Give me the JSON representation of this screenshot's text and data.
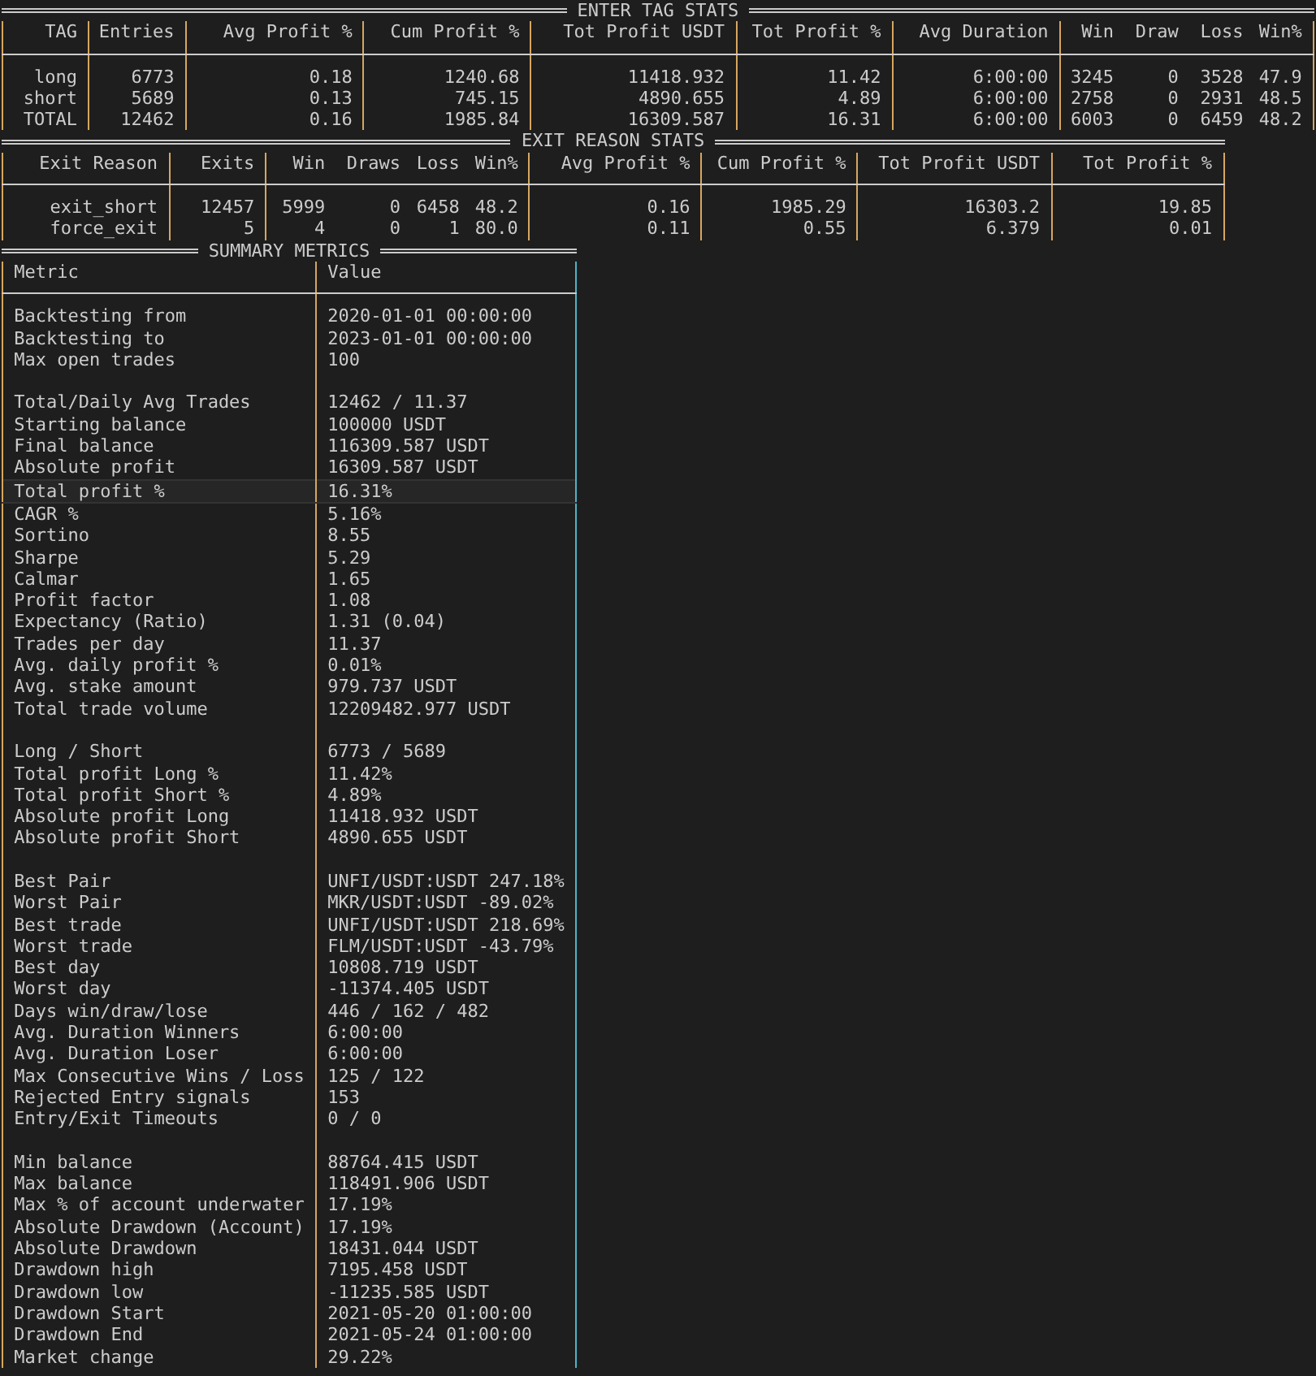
{
  "enter_tag_stats": {
    "title": "ENTER TAG STATS",
    "column_groups": [
      [
        "TAG"
      ],
      [
        "Entries"
      ],
      [
        "Avg Profit %"
      ],
      [
        "Cum Profit %"
      ],
      [
        "Tot Profit USDT"
      ],
      [
        "Tot Profit %"
      ],
      [
        "Avg Duration"
      ],
      [
        "Win",
        "Draw",
        "Loss",
        "Win%"
      ]
    ],
    "rows": [
      [
        "long",
        "6773",
        "0.18",
        "1240.68",
        "11418.932",
        "11.42",
        "6:00:00",
        "3245",
        "0",
        "3528",
        "47.9"
      ],
      [
        "short",
        "5689",
        "0.13",
        "745.15",
        "4890.655",
        "4.89",
        "6:00:00",
        "2758",
        "0",
        "2931",
        "48.5"
      ],
      [
        "TOTAL",
        "12462",
        "0.16",
        "1985.84",
        "16309.587",
        "16.31",
        "6:00:00",
        "6003",
        "0",
        "6459",
        "48.2"
      ]
    ]
  },
  "exit_reason_stats": {
    "title": "EXIT REASON STATS",
    "column_groups": [
      [
        "Exit Reason"
      ],
      [
        "Exits"
      ],
      [
        "Win",
        "Draws",
        "Loss",
        "Win%"
      ],
      [
        "Avg Profit %"
      ],
      [
        "Cum Profit %"
      ],
      [
        "Tot Profit USDT"
      ],
      [
        "Tot Profit %"
      ]
    ],
    "rows": [
      [
        "exit_short",
        "12457",
        "5999",
        "0",
        "6458",
        "48.2",
        "0.16",
        "1985.29",
        "16303.2",
        "19.85"
      ],
      [
        "force_exit",
        "5",
        "4",
        "0",
        "1",
        "80.0",
        "0.11",
        "0.55",
        "6.379",
        "0.01"
      ]
    ]
  },
  "summary_metrics": {
    "title": "SUMMARY METRICS",
    "columns": [
      "Metric",
      "Value"
    ],
    "groups": [
      [
        {
          "metric": "Backtesting from",
          "value": "2020-01-01 00:00:00",
          "selected": false
        },
        {
          "metric": "Backtesting to",
          "value": "2023-01-01 00:00:00",
          "selected": false
        },
        {
          "metric": "Max open trades",
          "value": "100",
          "selected": false
        }
      ],
      [
        {
          "metric": "Total/Daily Avg Trades",
          "value": "12462 / 11.37",
          "selected": false
        },
        {
          "metric": "Starting balance",
          "value": "100000 USDT",
          "selected": false
        },
        {
          "metric": "Final balance",
          "value": "116309.587 USDT",
          "selected": false
        },
        {
          "metric": "Absolute profit",
          "value": "16309.587 USDT",
          "selected": false
        },
        {
          "metric": "Total profit %",
          "value": "16.31%",
          "selected": true
        },
        {
          "metric": "CAGR %",
          "value": "5.16%",
          "selected": false
        },
        {
          "metric": "Sortino",
          "value": "8.55",
          "selected": false
        },
        {
          "metric": "Sharpe",
          "value": "5.29",
          "selected": false
        },
        {
          "metric": "Calmar",
          "value": "1.65",
          "selected": false
        },
        {
          "metric": "Profit factor",
          "value": "1.08",
          "selected": false
        },
        {
          "metric": "Expectancy (Ratio)",
          "value": "1.31 (0.04)",
          "selected": false
        },
        {
          "metric": "Trades per day",
          "value": "11.37",
          "selected": false
        },
        {
          "metric": "Avg. daily profit %",
          "value": "0.01%",
          "selected": false
        },
        {
          "metric": "Avg. stake amount",
          "value": "979.737 USDT",
          "selected": false
        },
        {
          "metric": "Total trade volume",
          "value": "12209482.977 USDT",
          "selected": false
        }
      ],
      [
        {
          "metric": "Long / Short",
          "value": "6773 / 5689",
          "selected": false
        },
        {
          "metric": "Total profit Long %",
          "value": "11.42%",
          "selected": false
        },
        {
          "metric": "Total profit Short %",
          "value": "4.89%",
          "selected": false
        },
        {
          "metric": "Absolute profit Long",
          "value": "11418.932 USDT",
          "selected": false
        },
        {
          "metric": "Absolute profit Short",
          "value": "4890.655 USDT",
          "selected": false
        }
      ],
      [
        {
          "metric": "Best Pair",
          "value": "UNFI/USDT:USDT 247.18%",
          "selected": false
        },
        {
          "metric": "Worst Pair",
          "value": "MKR/USDT:USDT -89.02%",
          "selected": false
        },
        {
          "metric": "Best trade",
          "value": "UNFI/USDT:USDT 218.69%",
          "selected": false
        },
        {
          "metric": "Worst trade",
          "value": "FLM/USDT:USDT -43.79%",
          "selected": false
        },
        {
          "metric": "Best day",
          "value": "10808.719 USDT",
          "selected": false
        },
        {
          "metric": "Worst day",
          "value": "-11374.405 USDT",
          "selected": false
        },
        {
          "metric": "Days win/draw/lose",
          "value": "446 / 162 / 482",
          "selected": false
        },
        {
          "metric": "Avg. Duration Winners",
          "value": "6:00:00",
          "selected": false
        },
        {
          "metric": "Avg. Duration Loser",
          "value": "6:00:00",
          "selected": false
        },
        {
          "metric": "Max Consecutive Wins / Loss",
          "value": "125 / 122",
          "selected": false
        },
        {
          "metric": "Rejected Entry signals",
          "value": "153",
          "selected": false
        },
        {
          "metric": "Entry/Exit Timeouts",
          "value": "0 / 0",
          "selected": false
        }
      ],
      [
        {
          "metric": "Min balance",
          "value": "88764.415 USDT",
          "selected": false
        },
        {
          "metric": "Max balance",
          "value": "118491.906 USDT",
          "selected": false
        },
        {
          "metric": "Max % of account underwater",
          "value": "17.19%",
          "selected": false
        },
        {
          "metric": "Absolute Drawdown (Account)",
          "value": "17.19%",
          "selected": false
        },
        {
          "metric": "Absolute Drawdown",
          "value": "18431.044 USDT",
          "selected": false
        },
        {
          "metric": "Drawdown high",
          "value": "7195.458 USDT",
          "selected": false
        },
        {
          "metric": "Drawdown low",
          "value": "-11235.585 USDT",
          "selected": false
        },
        {
          "metric": "Drawdown Start",
          "value": "2021-05-20 01:00:00",
          "selected": false
        },
        {
          "metric": "Drawdown End",
          "value": "2021-05-24 01:00:00",
          "selected": false
        },
        {
          "metric": "Market change",
          "value": "29.22%",
          "selected": false
        }
      ]
    ]
  }
}
